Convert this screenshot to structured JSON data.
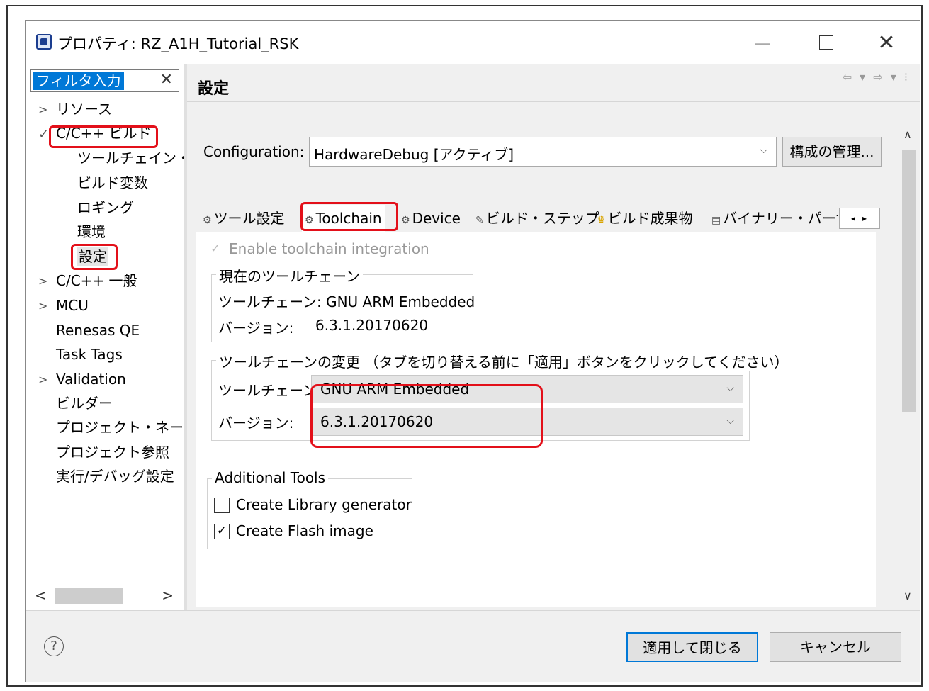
{
  "window": {
    "title": "プロパティ: RZ_A1H_Tutorial_RSK",
    "minimize": "—",
    "close": "✕"
  },
  "filter": {
    "value": "フィルタ入力",
    "clear": "✕"
  },
  "tree": {
    "items": [
      {
        "label": "リソース",
        "arrow": ">"
      },
      {
        "label": "C/C++ ビルド",
        "arrow": "✓"
      },
      {
        "label": "ツールチェイン・:"
      },
      {
        "label": "ビルド変数"
      },
      {
        "label": "ロギング"
      },
      {
        "label": "環境"
      },
      {
        "label": "設定"
      },
      {
        "label": "C/C++ 一般",
        "arrow": ">"
      },
      {
        "label": "MCU",
        "arrow": ">"
      },
      {
        "label": "Renesas QE"
      },
      {
        "label": "Task Tags"
      },
      {
        "label": "Validation",
        "arrow": ">"
      },
      {
        "label": "ビルダー"
      },
      {
        "label": "プロジェクト・ネーチ"
      },
      {
        "label": "プロジェクト参照"
      },
      {
        "label": "実行/デバッグ設定"
      }
    ],
    "scroll_left": "<",
    "scroll_right": ">"
  },
  "page": {
    "title": "設定",
    "nav": "⇦ ▾ ⇨ ▾ ⁝"
  },
  "config": {
    "label": "Configuration:",
    "value": "HardwareDebug [アクティブ]",
    "manage_button": "構成の管理..."
  },
  "tabs": [
    {
      "label": "ツール設定",
      "icon": "⚙"
    },
    {
      "label": "Toolchain",
      "icon": "⚙"
    },
    {
      "label": "Device",
      "icon": "⚙"
    },
    {
      "label": "ビルド・ステップ",
      "icon": "✎"
    },
    {
      "label": "ビルド成果物",
      "icon": "♛"
    },
    {
      "label": "バイナリー・パーサ",
      "icon": "▤"
    }
  ],
  "tab_scroll": "◂▸",
  "toolchain": {
    "enable_label": "Enable toolchain integration",
    "enable_checked": "✓",
    "current_group_title": "現在のツールチェーン",
    "current_toolchain_label": "ツールチェーン: GNU ARM Embedded",
    "current_version_label": "バージョン:",
    "current_version_value": "6.3.1.20170620",
    "change_group_title": "ツールチェーンの変更 （タブを切り替える前に「適用」ボタンをクリックしてください）",
    "change_toolchain_label": "ツールチェーン",
    "change_toolchain_value": "GNU ARM Embedded",
    "change_version_label": "バージョン:",
    "change_version_value": "6.3.1.20170620"
  },
  "additional_tools": {
    "title": "Additional Tools",
    "library_label": "Create Library generator",
    "library_checked": "",
    "flash_label": "Create Flash image",
    "flash_checked": "✓"
  },
  "buttons": {
    "help": "?",
    "apply_close": "適用して閉じる",
    "cancel": "キャンセル"
  },
  "colors": {
    "highlight": "#e3101a",
    "selection": "#0078d7"
  }
}
